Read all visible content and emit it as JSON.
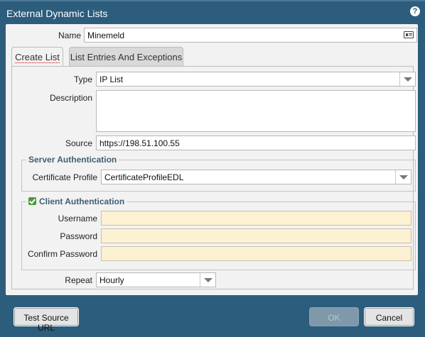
{
  "dialog": {
    "title": "External Dynamic Lists",
    "help_symbol": "?"
  },
  "name_field": {
    "label": "Name",
    "value": "Minemeld"
  },
  "tabs": [
    {
      "label": "Create List",
      "active": true
    },
    {
      "label": "List Entries And Exceptions",
      "active": false
    }
  ],
  "form": {
    "type": {
      "label": "Type",
      "value": "IP List"
    },
    "description": {
      "label": "Description",
      "value": ""
    },
    "source": {
      "label": "Source",
      "value": "https://198.51.100.55"
    },
    "server_auth": {
      "title": "Server Authentication",
      "cert_profile_label": "Certificate Profile",
      "cert_profile_value": "CertificateProfileEDL"
    },
    "client_auth": {
      "title": "Client Authentication",
      "checked": true,
      "username_label": "Username",
      "password_label": "Password",
      "confirm_label": "Confirm Password"
    },
    "repeat": {
      "label": "Repeat",
      "value": "Hourly"
    }
  },
  "buttons": {
    "test": "Test Source URL",
    "ok": "OK",
    "cancel": "Cancel"
  },
  "colors": {
    "frame": "#2c5d7d",
    "panel": "#f2f2f2",
    "legend": "#3d5f76",
    "check": "#4e9a3a",
    "yellow_field": "#fdf1d3"
  }
}
